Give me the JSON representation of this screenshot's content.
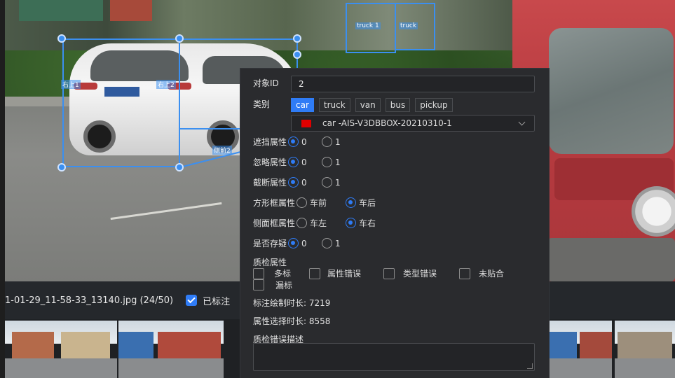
{
  "scene": {
    "box_labels": [
      "右上1",
      "右上2",
      "侧前2",
      "truck 1",
      "truck"
    ]
  },
  "file_bar": {
    "file_name": "1-01-29_11-58-33_13140.jpg (24/50)",
    "labeled_label": "已标注"
  },
  "panel": {
    "object_id_label": "对象ID",
    "object_id_value": "2",
    "class_label": "类别",
    "class_tags": [
      "car",
      "truck",
      "van",
      "bus",
      "pickup"
    ],
    "selected_class": "car",
    "class_select_text": "car -AIS-V3DBBOX-20210310-1",
    "class_color": "#e00000",
    "attributes": [
      {
        "label": "遮挡属性",
        "options": [
          "0",
          "1"
        ],
        "selected": 0
      },
      {
        "label": "忽略属性",
        "options": [
          "0",
          "1"
        ],
        "selected": 0
      },
      {
        "label": "截断属性",
        "options": [
          "0",
          "1"
        ],
        "selected": 0
      },
      {
        "label": "方形框属性",
        "options": [
          "车前",
          "车后"
        ],
        "selected": 1
      },
      {
        "label": "侧面框属性",
        "options": [
          "车左",
          "车右"
        ],
        "selected": 1
      },
      {
        "label": "是否存疑",
        "options": [
          "0",
          "1"
        ],
        "selected": 0
      }
    ],
    "qc_label": "质检属性",
    "qc_options": [
      "多标",
      "属性错误",
      "类型错误",
      "未贴合",
      "漏标"
    ],
    "draw_time": "标注绘制时长: 7219",
    "select_time": "属性选择时长: 8558",
    "qc_desc_label": "质检错误描述",
    "qc_desc_value": ""
  },
  "colors": {
    "accent": "#2f7cf6",
    "box": "#3b8ff0",
    "panel_bg": "#2a2b2e"
  }
}
